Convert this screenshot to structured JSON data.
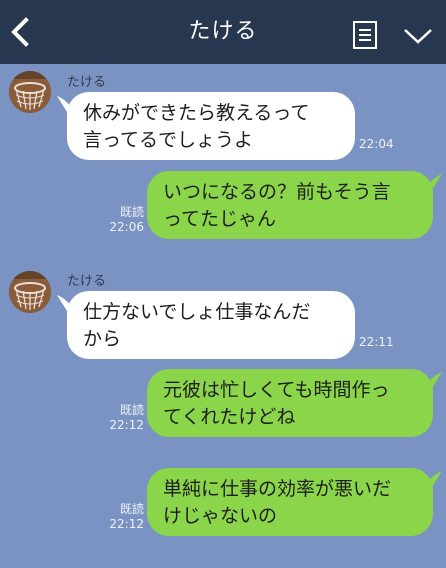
{
  "header": {
    "title": "たける"
  },
  "colors": {
    "header_bg": "#283750",
    "chat_bg": "#7b93c2",
    "incoming_bubble": "#ffffff",
    "outgoing_bubble": "#8bd54a"
  },
  "icons": {
    "back": "chevron-left-icon",
    "note": "note-icon",
    "menu": "chevron-down-icon"
  },
  "messages": [
    {
      "side": "in",
      "sender": "たける",
      "lines": [
        "休みができたら教えるって",
        "言ってるでしょうよ"
      ],
      "time": "22:04"
    },
    {
      "side": "out",
      "read": "既読",
      "lines": [
        "いつになるの？前もそう言",
        "ってたじゃん"
      ],
      "time": "22:06"
    },
    {
      "side": "in",
      "sender": "たける",
      "lines": [
        "仕方ないでしょ仕事なんだ",
        "から"
      ],
      "time": "22:11"
    },
    {
      "side": "out",
      "read": "既読",
      "lines": [
        "元彼は忙しくても時間作っ",
        "てくれたけどね"
      ],
      "time": "22:12"
    },
    {
      "side": "out",
      "read": "既読",
      "lines": [
        "単純に仕事の効率が悪いだ",
        "けじゃないの"
      ],
      "time": "22:12"
    }
  ]
}
